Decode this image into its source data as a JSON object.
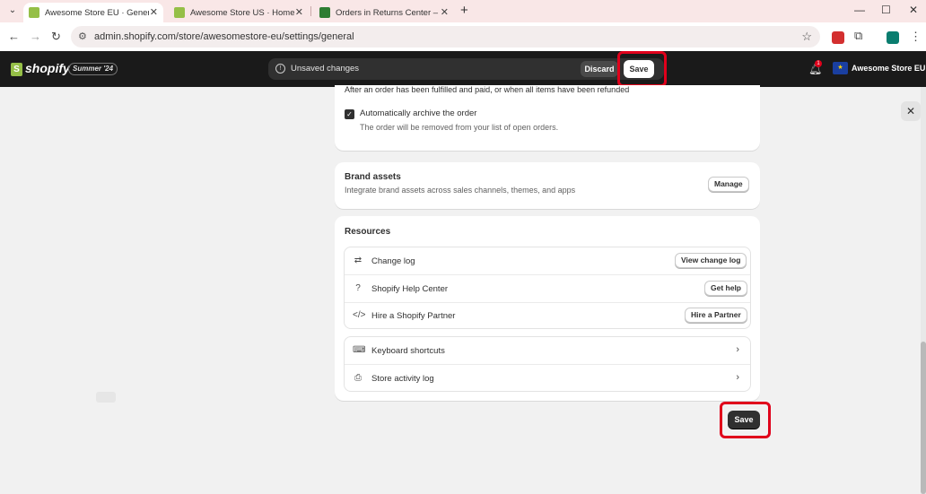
{
  "browser": {
    "tabs": [
      {
        "title": "Awesome Store EU · General · S",
        "active": true
      },
      {
        "title": "Awesome Store US · Home · Sh",
        "active": false
      },
      {
        "title": "Orders in Returns Center – Den",
        "active": false
      }
    ],
    "url": "admin.shopify.com/store/awesomestore-eu/settings/general"
  },
  "header": {
    "logo": "shopify",
    "edition_badge": "Summer '24",
    "unsaved_label": "Unsaved changes",
    "discard_label": "Discard",
    "save_label": "Save",
    "notification_count": "1",
    "store_name": "Awesome Store EU"
  },
  "archive": {
    "description": "After an order has been fulfilled and paid, or when all items have been refunded",
    "checkbox_label": "Automatically archive the order",
    "checkbox_checked": true,
    "checkbox_help": "The order will be removed from your list of open orders."
  },
  "brand_assets": {
    "title": "Brand assets",
    "description": "Integrate brand assets across sales channels, themes, and apps",
    "button": "Manage"
  },
  "resources": {
    "title": "Resources",
    "links": [
      {
        "icon": "change-log-icon",
        "label": "Change log",
        "button": "View change log"
      },
      {
        "icon": "help-circle-icon",
        "label": "Shopify Help Center",
        "button": "Get help"
      },
      {
        "icon": "code-icon",
        "label": "Hire a Shopify Partner",
        "button": "Hire a Partner"
      }
    ],
    "nav": [
      {
        "icon": "keyboard-icon",
        "label": "Keyboard shortcuts"
      },
      {
        "icon": "activity-log-icon",
        "label": "Store activity log"
      }
    ]
  },
  "footer": {
    "save_label": "Save"
  },
  "colors": {
    "highlight": "#e0001b",
    "topbar": "#1a1a1a",
    "brand_green": "#95bf47"
  }
}
